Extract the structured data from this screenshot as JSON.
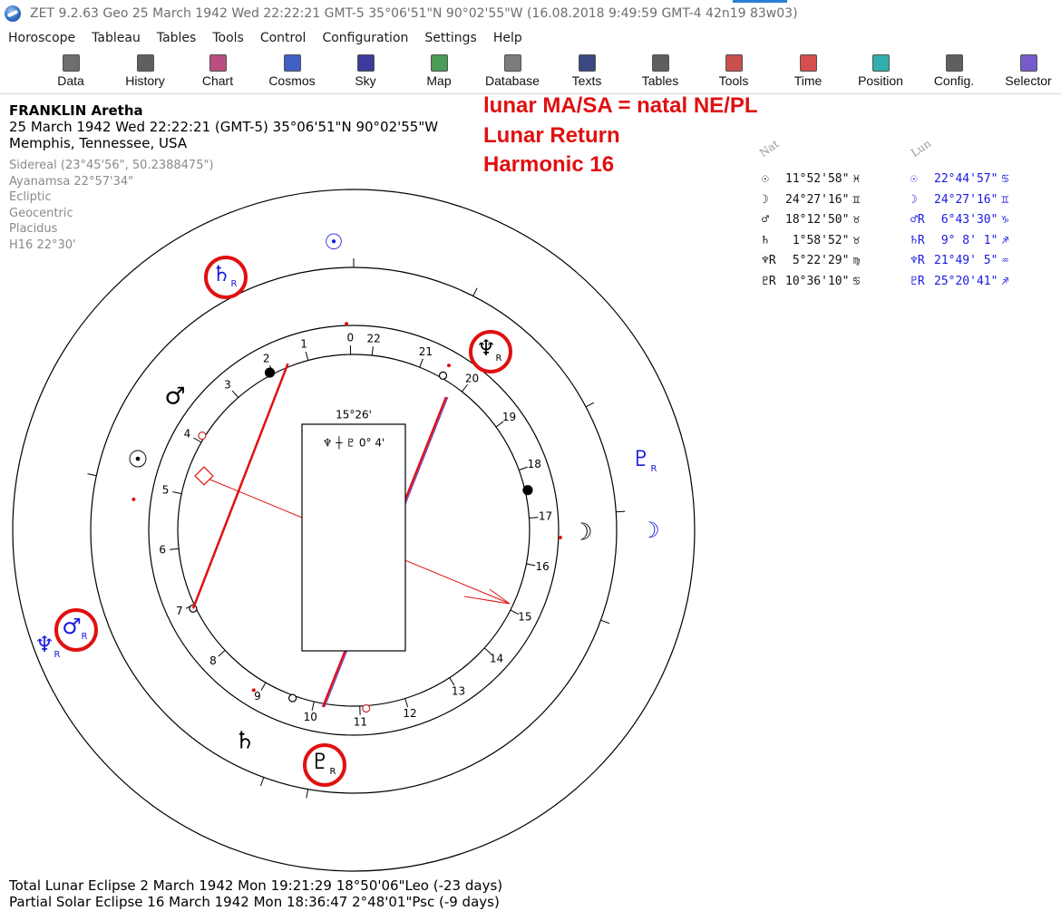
{
  "window": {
    "title": "ZET 9.2.63 Geo    25 March 1942  Wed   22:22:21 GMT-5 35°06'51\"N  90°02'55\"W   (16.08.2018    9:49:59 GMT-4 42n19 83w03)"
  },
  "menu": [
    "Horoscope",
    "Tableau",
    "Tables",
    "Tools",
    "Control",
    "Configuration",
    "Settings",
    "Help"
  ],
  "toolbar": [
    {
      "label": "Data",
      "icon": "data-icon",
      "color": "#555555"
    },
    {
      "label": "History",
      "icon": "history-icon",
      "color": "#444444"
    },
    {
      "label": "Chart",
      "icon": "chart-icon",
      "color": "#b0306a"
    },
    {
      "label": "Cosmos",
      "icon": "cosmos-icon",
      "color": "#2244bb"
    },
    {
      "label": "Sky",
      "icon": "sky-icon",
      "color": "#1a1a8a"
    },
    {
      "label": "Map",
      "icon": "map-icon",
      "color": "#2a8a3a"
    },
    {
      "label": "Database",
      "icon": "database-icon",
      "color": "#666666"
    },
    {
      "label": "Texts",
      "icon": "texts-icon",
      "color": "#1a2a6a"
    },
    {
      "label": "Tables",
      "icon": "tables-icon",
      "color": "#444444"
    },
    {
      "label": "Tools",
      "icon": "tools-icon",
      "color": "#c03030"
    },
    {
      "label": "Time",
      "icon": "time-icon",
      "color": "#d03030"
    },
    {
      "label": "Position",
      "icon": "position-icon",
      "color": "#10a0a0"
    },
    {
      "label": "Config.",
      "icon": "config-icon",
      "color": "#444444"
    },
    {
      "label": "Selector",
      "icon": "selector-icon",
      "color": "#6040c0"
    }
  ],
  "person": {
    "name": "FRANKLIN Aretha",
    "datetime": "25 March 1942  Wed  22:22:21 (GMT-5) 35°06'51\"N  90°02'55\"W",
    "place": "Memphis, Tennessee, USA"
  },
  "settings_lines": [
    "Sidereal (23°45'56\", 50.2388475\")",
    "Ayanamsa 22°57'34\"",
    "Ecliptic",
    "Geocentric",
    "Placidus",
    "H16  22°30'"
  ],
  "annotation": [
    "lunar MA/SA = natal NE/PL",
    "Lunar Return",
    "Harmonic 16"
  ],
  "table": {
    "nat_header": "Nat",
    "lun_header": "Lun",
    "nat": [
      {
        "glyph": "☉",
        "value": "11°52'58\"",
        "sign": "♓"
      },
      {
        "glyph": "☽",
        "value": "24°27'16\"",
        "sign": "♊"
      },
      {
        "glyph": "♂",
        "value": "18°12'50\"",
        "sign": "♉"
      },
      {
        "glyph": "♄",
        "value": " 1°58'52\"",
        "sign": "♉"
      },
      {
        "glyph": "♆R",
        "value": " 5°22'29\"",
        "sign": "♍"
      },
      {
        "glyph": "♇R",
        "value": "10°36'10\"",
        "sign": "♋"
      }
    ],
    "lun": [
      {
        "glyph": "☉",
        "value": "22°44'57\"",
        "sign": "♋"
      },
      {
        "glyph": "☽",
        "value": "24°27'16\"",
        "sign": "♊"
      },
      {
        "glyph": "♂R",
        "value": " 6°43'30\"",
        "sign": "♑"
      },
      {
        "glyph": "♄R",
        "value": " 9° 8' 1\"",
        "sign": "♐"
      },
      {
        "glyph": "♆R",
        "value": "21°49' 5\"",
        "sign": "♒"
      },
      {
        "glyph": "♇R",
        "value": "25°20'41\"",
        "sign": "♐"
      }
    ]
  },
  "wheel": {
    "house_numbers": [
      "1",
      "2",
      "3",
      "4",
      "5",
      "6",
      "7",
      "8",
      "9",
      "10",
      "11",
      "12",
      "13",
      "14",
      "15",
      "16",
      "17",
      "18",
      "19",
      "20",
      "21",
      "22",
      "0"
    ],
    "box_degree": "15°26'",
    "box_aspect": "♆ ┼ ♇   0° 4'",
    "inner_glyphs": [
      {
        "glyph": "♂",
        "color": "#000000"
      },
      {
        "glyph": "☉",
        "color": "#000000"
      },
      {
        "glyph": "♄",
        "color": "#000000"
      },
      {
        "glyph": "☽",
        "color": "#000000"
      }
    ],
    "outer_glyphs": [
      {
        "glyph": "♄",
        "retro": "R",
        "color": "#1a1ae0",
        "circled": true
      },
      {
        "glyph": "☉",
        "retro": "",
        "color": "#1a1ae0",
        "circled": false
      },
      {
        "glyph": "♆",
        "retro": "R",
        "color": "#000000",
        "circled": true
      },
      {
        "glyph": "♇",
        "retro": "R",
        "color": "#1a1ae0",
        "circled": false
      },
      {
        "glyph": "☽",
        "retro": "",
        "color": "#1a1ae0",
        "circled": false
      },
      {
        "glyph": "♂",
        "retro": "R",
        "color": "#1a1ae0",
        "circled": true
      },
      {
        "glyph": "♆",
        "retro": "R",
        "color": "#1a1ae0",
        "circled": false
      },
      {
        "glyph": "♇",
        "retro": "R",
        "color": "#000000",
        "circled": true
      }
    ],
    "accent_red": "#e01010",
    "accent_blue": "#1a1ae0"
  },
  "eclipses": [
    "Total Lunar Eclipse 2 March 1942 Mon 19:21:29 18°50'06\"Leo (-23 days)",
    "Partial Solar Eclipse 16 March 1942 Mon 18:36:47  2°48'01\"Psc (-9 days)"
  ]
}
